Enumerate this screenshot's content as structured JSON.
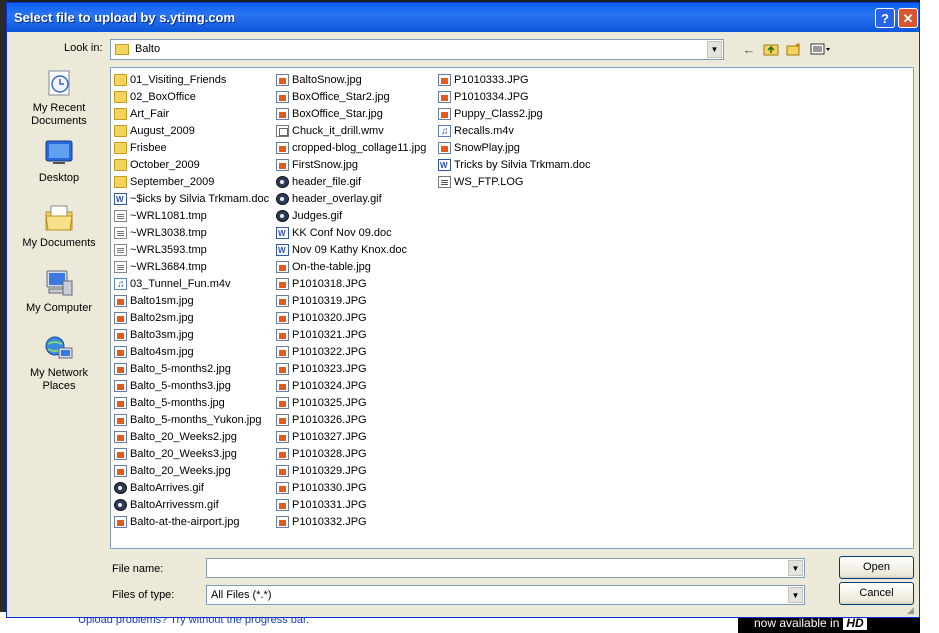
{
  "background": {
    "link_text": "Upload problems? Try without the progress bar.",
    "hd_text": "now available in",
    "hd_badge": "HD"
  },
  "dialog": {
    "title": "Select file to upload by s.ytimg.com",
    "help_label": "?",
    "close_label": "✕",
    "look_in_label": "Look in:",
    "look_in_value": "Balto"
  },
  "places": [
    {
      "label": "My Recent Documents",
      "icon": "recent-documents-icon"
    },
    {
      "label": "Desktop",
      "icon": "desktop-icon"
    },
    {
      "label": "My Documents",
      "icon": "my-documents-icon"
    },
    {
      "label": "My Computer",
      "icon": "my-computer-icon"
    },
    {
      "label": "My Network Places",
      "icon": "network-places-icon"
    }
  ],
  "files": {
    "col1": [
      {
        "name": "01_Visiting_Friends",
        "type": "folder"
      },
      {
        "name": "02_BoxOffice",
        "type": "folder"
      },
      {
        "name": "Art_Fair",
        "type": "folder"
      },
      {
        "name": "August_2009",
        "type": "folder"
      },
      {
        "name": "Frisbee",
        "type": "folder"
      },
      {
        "name": "October_2009",
        "type": "folder"
      },
      {
        "name": "September_2009",
        "type": "folder"
      },
      {
        "name": "~$icks by Silvia Trkmam.doc",
        "type": "doc"
      },
      {
        "name": "~WRL1081.tmp",
        "type": "tmp"
      },
      {
        "name": "~WRL3038.tmp",
        "type": "tmp"
      },
      {
        "name": "~WRL3593.tmp",
        "type": "tmp"
      },
      {
        "name": "~WRL3684.tmp",
        "type": "tmp"
      },
      {
        "name": "03_Tunnel_Fun.m4v",
        "type": "m4v"
      },
      {
        "name": "Balto1sm.jpg",
        "type": "jpg"
      },
      {
        "name": "Balto2sm.jpg",
        "type": "jpg"
      },
      {
        "name": "Balto3sm.jpg",
        "type": "jpg"
      },
      {
        "name": "Balto4sm.jpg",
        "type": "jpg"
      },
      {
        "name": "Balto_5-months2.jpg",
        "type": "jpg"
      },
      {
        "name": "Balto_5-months3.jpg",
        "type": "jpg"
      },
      {
        "name": "Balto_5-months.jpg",
        "type": "jpg"
      },
      {
        "name": "Balto_5-months_Yukon.jpg",
        "type": "jpg"
      },
      {
        "name": "Balto_20_Weeks2.jpg",
        "type": "jpg"
      },
      {
        "name": "Balto_20_Weeks3.jpg",
        "type": "jpg"
      },
      {
        "name": "Balto_20_Weeks.jpg",
        "type": "jpg"
      },
      {
        "name": "BaltoArrives.gif",
        "type": "gif"
      },
      {
        "name": "BaltoArrivessm.gif",
        "type": "gif"
      },
      {
        "name": "Balto-at-the-airport.jpg",
        "type": "jpg"
      }
    ],
    "col2": [
      {
        "name": "BaltoSnow.jpg",
        "type": "jpg"
      },
      {
        "name": "BoxOffice_Star2.jpg",
        "type": "jpg"
      },
      {
        "name": "BoxOffice_Star.jpg",
        "type": "jpg"
      },
      {
        "name": "Chuck_it_drill.wmv",
        "type": "wmv"
      },
      {
        "name": "cropped-blog_collage11.jpg",
        "type": "jpg"
      },
      {
        "name": "FirstSnow.jpg",
        "type": "jpg"
      },
      {
        "name": "header_file.gif",
        "type": "gif"
      },
      {
        "name": "header_overlay.gif",
        "type": "gif"
      },
      {
        "name": "Judges.gif",
        "type": "gif"
      },
      {
        "name": "KK Conf Nov 09.doc",
        "type": "doc"
      },
      {
        "name": "Nov 09 Kathy Knox.doc",
        "type": "doc"
      },
      {
        "name": "On-the-table.jpg",
        "type": "jpg"
      },
      {
        "name": "P1010318.JPG",
        "type": "jpg"
      },
      {
        "name": "P1010319.JPG",
        "type": "jpg"
      },
      {
        "name": "P1010320.JPG",
        "type": "jpg"
      },
      {
        "name": "P1010321.JPG",
        "type": "jpg"
      },
      {
        "name": "P1010322.JPG",
        "type": "jpg"
      },
      {
        "name": "P1010323.JPG",
        "type": "jpg"
      },
      {
        "name": "P1010324.JPG",
        "type": "jpg"
      },
      {
        "name": "P1010325.JPG",
        "type": "jpg"
      },
      {
        "name": "P1010326.JPG",
        "type": "jpg"
      },
      {
        "name": "P1010327.JPG",
        "type": "jpg"
      },
      {
        "name": "P1010328.JPG",
        "type": "jpg"
      },
      {
        "name": "P1010329.JPG",
        "type": "jpg"
      },
      {
        "name": "P1010330.JPG",
        "type": "jpg"
      },
      {
        "name": "P1010331.JPG",
        "type": "jpg"
      },
      {
        "name": "P1010332.JPG",
        "type": "jpg"
      }
    ],
    "col3": [
      {
        "name": "P1010333.JPG",
        "type": "jpg"
      },
      {
        "name": "P1010334.JPG",
        "type": "jpg"
      },
      {
        "name": "Puppy_Class2.jpg",
        "type": "jpg"
      },
      {
        "name": "Recalls.m4v",
        "type": "m4v"
      },
      {
        "name": "SnowPlay.jpg",
        "type": "jpg"
      },
      {
        "name": "Tricks by Silvia Trkmam.doc",
        "type": "doc"
      },
      {
        "name": "WS_FTP.LOG",
        "type": "log"
      }
    ]
  },
  "footer": {
    "file_name_label": "File name:",
    "file_name_value": "",
    "file_type_label": "Files of type:",
    "file_type_value": "All Files (*.*)",
    "open_label": "Open",
    "cancel_label": "Cancel"
  }
}
